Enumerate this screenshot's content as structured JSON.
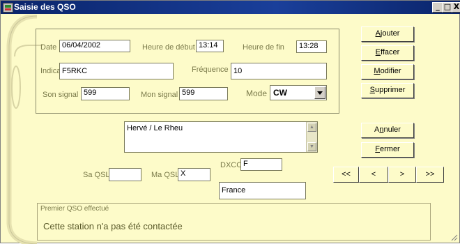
{
  "window": {
    "title": "Saisie des QSO"
  },
  "titlebar_buttons": {
    "minimize": "_",
    "maximize": "□",
    "close": "X"
  },
  "form": {
    "date": {
      "label": "Date",
      "value": "06/04/2002"
    },
    "heure_debut": {
      "label": "Heure de début",
      "value": "13:14"
    },
    "heure_fin": {
      "label": "Heure de fin",
      "value": "13:28"
    },
    "indicatif": {
      "label": "Indicatif",
      "value": "F5RKC"
    },
    "frequence": {
      "label": "Fréquence",
      "value": "10"
    },
    "son_signal": {
      "label": "Son signal",
      "value": "599"
    },
    "mon_signal": {
      "label": "Mon signal",
      "value": "599"
    },
    "mode": {
      "label": "Mode",
      "value": "CW"
    }
  },
  "actions": {
    "ajouter": {
      "pre": "",
      "u": "A",
      "post": "jouter"
    },
    "effacer": {
      "pre": "",
      "u": "E",
      "post": "ffacer"
    },
    "modifier": {
      "pre": "",
      "u": "M",
      "post": "odifier"
    },
    "supprimer": {
      "pre": "",
      "u": "S",
      "post": "upprimer"
    },
    "annuler": {
      "pre": "A",
      "u": "n",
      "post": "nuler"
    },
    "fermer": {
      "pre": "",
      "u": "F",
      "post": "ermer"
    }
  },
  "comment": {
    "value": "Hervé / Le Rheu"
  },
  "qsl": {
    "sa_qsl": {
      "label": "Sa QSL",
      "value": ""
    },
    "ma_qsl": {
      "label": "Ma QSL",
      "value": "X"
    }
  },
  "dxcc": {
    "label": "DXCC",
    "value": "F",
    "country": "France"
  },
  "nav": {
    "first": "<<",
    "prev": "<",
    "next": ">",
    "last": ">>"
  },
  "status": {
    "title": "Premier QSO effectué",
    "message": "Cette station n'a pas été contactée"
  },
  "colors": {
    "background": "#fdfbc9",
    "titlebar": "#0a246a"
  }
}
